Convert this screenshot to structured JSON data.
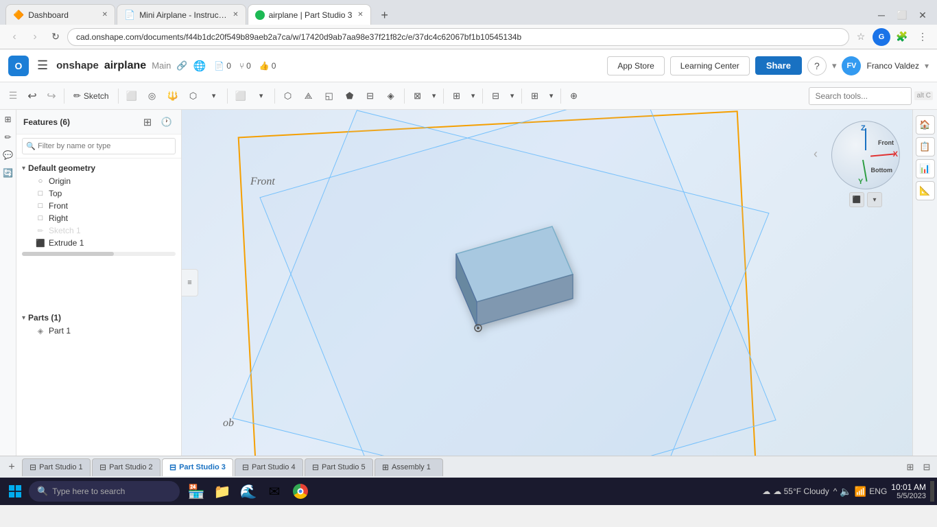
{
  "browser": {
    "tabs": [
      {
        "id": "tab1",
        "title": "Dashboard",
        "icon": "🔶",
        "active": false,
        "closable": true
      },
      {
        "id": "tab2",
        "title": "Mini Airplane - Instructables",
        "icon": "📄",
        "active": false,
        "closable": true
      },
      {
        "id": "tab3",
        "title": "airplane | Part Studio 3",
        "icon": "🟢",
        "active": true,
        "closable": true
      }
    ],
    "new_tab_label": "+",
    "address": "cad.onshape.com/documents/f44b1dc20f549b89aeb2a7ca/w/17420d9ab7aa98e37f21f82c/e/37dc4c62067bf1b10545134b"
  },
  "appbar": {
    "logo_letter": "O",
    "brand": "onshape",
    "menu_icon": "☰",
    "doc_title": "airplane",
    "doc_main": "Main",
    "link_icon": "🔗",
    "globe_icon": "🌐",
    "stat_doc": "0",
    "stat_branch": "0",
    "stat_like": "0",
    "app_store_label": "App Store",
    "learning_center_label": "Learning Center",
    "share_label": "Share",
    "help_icon": "?",
    "user_initials": "FV",
    "user_name": "Franco Valdez"
  },
  "toolbar": {
    "undo_label": "",
    "redo_label": "",
    "sketch_label": "Sketch",
    "search_placeholder": "Search tools...",
    "shortcut_hint": "alt C"
  },
  "sidebar": {
    "features_label": "Features (6)",
    "filter_placeholder": "Filter by name or type",
    "default_geometry_label": "Default geometry",
    "items": [
      {
        "label": "Origin",
        "icon": "○",
        "type": "origin"
      },
      {
        "label": "Top",
        "icon": "□",
        "type": "plane"
      },
      {
        "label": "Front",
        "icon": "□",
        "type": "plane"
      },
      {
        "label": "Right",
        "icon": "□",
        "type": "plane"
      },
      {
        "label": "Sketch 1",
        "icon": "✏",
        "type": "sketch",
        "disabled": true
      },
      {
        "label": "Extrude 1",
        "icon": "□",
        "type": "extrude"
      }
    ],
    "parts_label": "Parts (1)",
    "parts": [
      {
        "label": "Part 1",
        "icon": "◈",
        "type": "part"
      }
    ]
  },
  "viewport": {
    "plane_front_label": "Front",
    "plane_ob_label": "ob",
    "view_widget": {
      "front_label": "Front",
      "bottom_label": "Bottom",
      "x_label": "X",
      "y_label": "Y",
      "z_label": "Z"
    }
  },
  "bottom_tabs": {
    "tabs": [
      {
        "label": "Part Studio 1",
        "active": false
      },
      {
        "label": "Part Studio 2",
        "active": false
      },
      {
        "label": "Part Studio 3",
        "active": true
      },
      {
        "label": "Part Studio 4",
        "active": false
      },
      {
        "label": "Part Studio 5",
        "active": false
      },
      {
        "label": "Assembly 1",
        "active": false,
        "icon_type": "assembly"
      }
    ],
    "add_label": "+"
  },
  "taskbar": {
    "search_placeholder": "Type here to search",
    "weather": "☁ 55°F  Cloudy",
    "language": "ENG",
    "time": "10:01 AM",
    "date": "5/5/2023"
  }
}
